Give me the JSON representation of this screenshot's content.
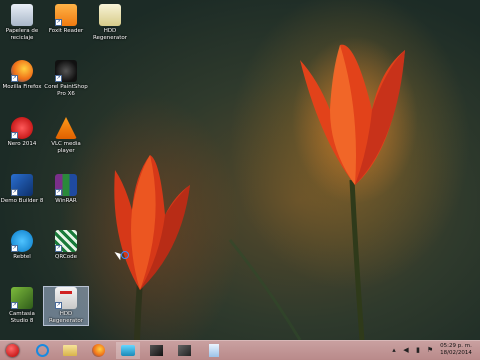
{
  "desktop": {
    "icons": [
      {
        "name": "recycle-bin-icon",
        "label": "Papelera de reciclaje"
      },
      {
        "name": "foxit-reader-icon",
        "label": "Foxit Reader"
      },
      {
        "name": "hdd-regenerator-folder-icon",
        "label": "HDD Regenerator"
      },
      {
        "name": "firefox-icon",
        "label": "Mozilla Firefox"
      },
      {
        "name": "corel-paintshop-icon",
        "label": "Corel PaintShop Pro X6"
      },
      {
        "name": "nero-icon",
        "label": "Nero 2014"
      },
      {
        "name": "vlc-icon",
        "label": "VLC media player"
      },
      {
        "name": "demo-builder-icon",
        "label": "Demo Builder 8"
      },
      {
        "name": "winrar-icon",
        "label": "WinRAR"
      },
      {
        "name": "rebtel-icon",
        "label": "Rebtel"
      },
      {
        "name": "qrcode-icon",
        "label": "QRCode"
      },
      {
        "name": "camtasia-icon",
        "label": "Camtasia Studio 8"
      },
      {
        "name": "hdd-regenerator-icon",
        "label": "HDD Regenerator"
      }
    ]
  },
  "taskbar": {
    "clock_time": "05:29 p. m.",
    "clock_date": "18/02/2014"
  }
}
